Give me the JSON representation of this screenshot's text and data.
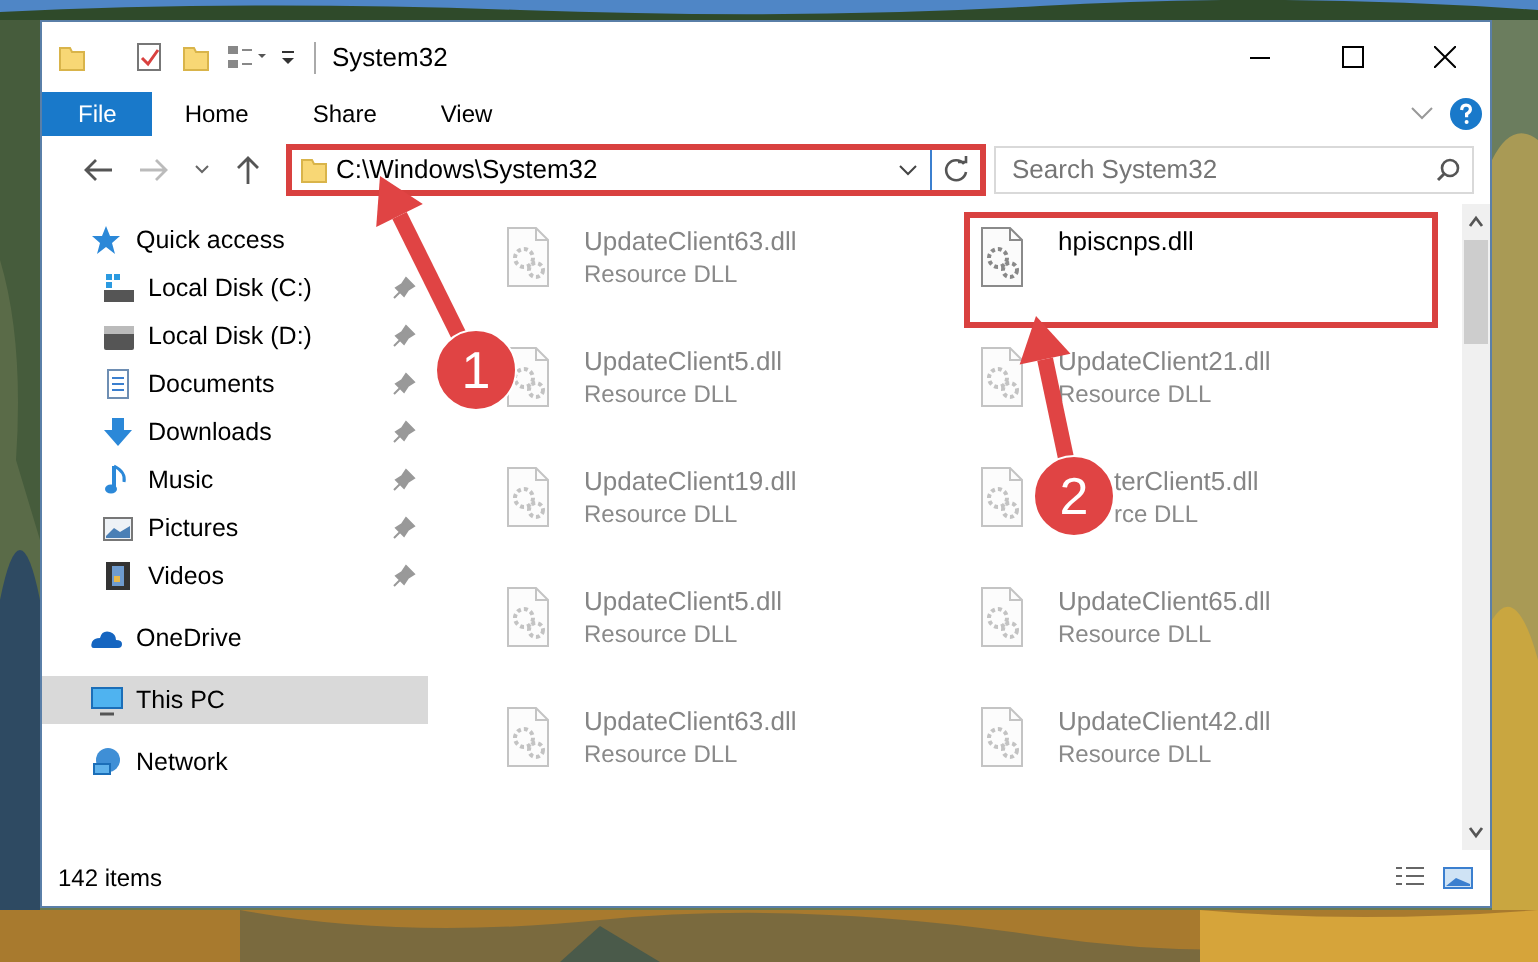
{
  "window": {
    "title": "System32"
  },
  "ribbon": {
    "tabs": [
      {
        "label": "File",
        "kind": "file"
      },
      {
        "label": "Home",
        "kind": "tab"
      },
      {
        "label": "Share",
        "kind": "tab"
      },
      {
        "label": "View",
        "kind": "tab"
      }
    ]
  },
  "address": {
    "path": "C:\\Windows\\System32",
    "highlighted": true
  },
  "search": {
    "placeholder": "Search System32"
  },
  "sidebar": {
    "items": [
      {
        "label": "Quick access",
        "kind": "quick-access",
        "selected": false,
        "children": [
          {
            "label": "Local Disk (C:)",
            "kind": "drive-system",
            "selected": false,
            "pinned": true
          },
          {
            "label": "Local Disk (D:)",
            "kind": "drive",
            "selected": false,
            "pinned": true
          },
          {
            "label": "Documents",
            "kind": "documents",
            "selected": false,
            "pinned": true
          },
          {
            "label": "Downloads",
            "kind": "downloads",
            "selected": false,
            "pinned": true
          },
          {
            "label": "Music",
            "kind": "music",
            "selected": false,
            "pinned": true
          },
          {
            "label": "Pictures",
            "kind": "pictures",
            "selected": false,
            "pinned": true
          },
          {
            "label": "Videos",
            "kind": "videos",
            "selected": false,
            "pinned": true
          }
        ]
      },
      {
        "label": "OneDrive",
        "kind": "onedrive",
        "selected": false
      },
      {
        "label": "This PC",
        "kind": "pc",
        "selected": true
      },
      {
        "label": "Network",
        "kind": "network",
        "selected": false
      }
    ]
  },
  "files": [
    {
      "name": "UpdateClient63.dll",
      "type": "Resource DLL",
      "kind": "plain",
      "faded": true,
      "highlighted": false
    },
    {
      "name": "hpiscnps.dll",
      "kind": "plain",
      "faded": false,
      "highlighted": true
    },
    {
      "name": "UpdateClient5.dll",
      "type": "Resource DLL",
      "kind": "plain",
      "faded": true,
      "highlighted": false
    },
    {
      "name": "UpdateClient21.dll",
      "type": "Resource DLL",
      "kind": "plain",
      "faded": true,
      "highlighted": false
    },
    {
      "name": "UpdateClient19.dll",
      "type": "Resource DLL",
      "kind": "plain",
      "faded": true,
      "highlighted": false
    },
    {
      "name": "terClient5.dll",
      "type": "rce DLL",
      "kind": "partly-hidden",
      "faded": true,
      "highlighted": false
    },
    {
      "name": "UpdateClient5.dll",
      "type": "Resource DLL",
      "kind": "plain",
      "faded": true,
      "highlighted": false
    },
    {
      "name": "UpdateClient65.dll",
      "type": "Resource DLL",
      "kind": "plain",
      "faded": true,
      "highlighted": false
    },
    {
      "name": "UpdateClient63.dll",
      "type": "Resource DLL",
      "kind": "plain",
      "faded": true,
      "highlighted": false
    },
    {
      "name": "UpdateClient42.dll",
      "type": "Resource DLL",
      "kind": "plain",
      "faded": true,
      "highlighted": false
    }
  ],
  "status_bar": {
    "item_count": "142 items"
  },
  "annotations": [
    {
      "label": "1"
    },
    {
      "label": "2"
    }
  ]
}
